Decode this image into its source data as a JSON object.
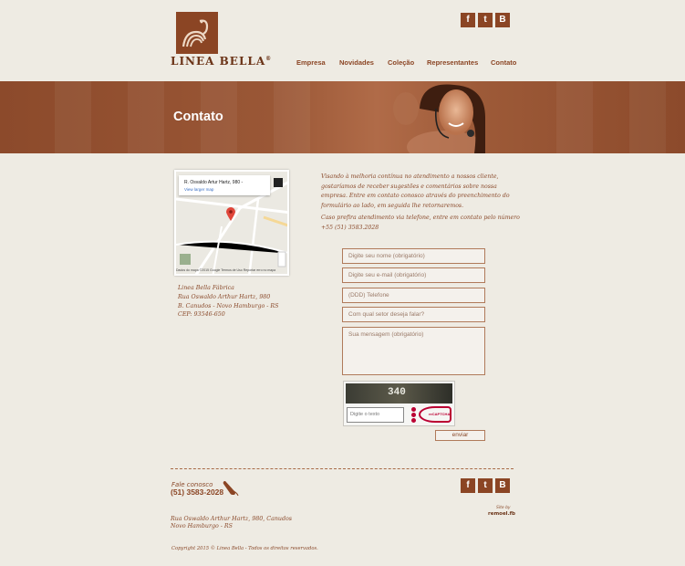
{
  "brand": {
    "logo_text": "LINEA BELLA",
    "registered": "®"
  },
  "social": {
    "facebook": "f",
    "twitter": "t",
    "blogger": "B"
  },
  "nav": {
    "items": [
      "Empresa",
      "Novidades",
      "Coleção",
      "Representantes",
      "Contato"
    ]
  },
  "banner": {
    "title": "Contato"
  },
  "map": {
    "address": "R. Osvaldo Artur Hartz, 980 -",
    "link": "View larger map",
    "footer": "Dados do mapa ©2015 Google  Termos de Uso  Reportar erro no mapa"
  },
  "address": {
    "lines": [
      "Linea Bella Fábrica",
      "Rua Oswaldo Arthur Hartz, 980",
      "B. Canudos - Novo Hamburgo - RS",
      "CEP: 93546-650"
    ]
  },
  "intro": {
    "paragraph1": "Visando à melhoria contínua no atendimento a nossos cliente, gostaríamos de receber sugestões e comentários sobre nossa empresa. Entre em contato conosco através do preenchimento do formulário ao lado, em seguida lhe retornaremos.",
    "paragraph2": "Caso prefira atendimento via telefone, entre em contato pelo número +55 (51) 3583.2028"
  },
  "form": {
    "name_placeholder": "Digite seu nome (obrigatório)",
    "email_placeholder": "Digite seu e-mail (obrigatório)",
    "phone_placeholder": "(DDD) Telefone",
    "sector_placeholder": "Com qual setor deseja falar?",
    "message_placeholder": "Sua mensagem (obrigatório)",
    "captcha_value": "340",
    "captcha_placeholder": "Digite o texto",
    "captcha_brand": "reCAPTCHA",
    "send_label": "enviar"
  },
  "footer": {
    "fale_label": "Fale conosco",
    "phone": "(51) 3583-2028",
    "address_line1": "Rua Oswaldo Arthur Hartz, 980, Canudos",
    "address_line2": "Novo Hamburgo - RS",
    "site_by": "Site by",
    "site_brand": "remoel.fb",
    "copyright": "Copyright 2015 © Linea Bella - Todos os direitos reservados."
  },
  "colors": {
    "brand": "#8b4524",
    "background": "#eeebe3",
    "banner": "#9a5736"
  }
}
